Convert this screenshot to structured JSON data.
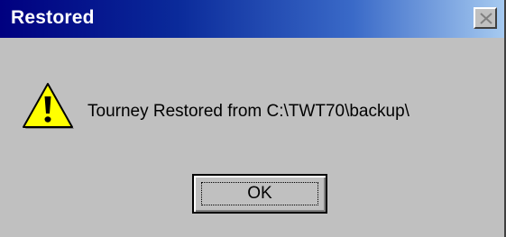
{
  "window": {
    "title": "Restored",
    "close_icon": "close-icon"
  },
  "message": {
    "icon": "warning-icon",
    "text": "Tourney Restored from C:\\TWT70\\backup\\"
  },
  "buttons": {
    "ok_label": "OK"
  },
  "colors": {
    "titlebar_start": "#000080",
    "titlebar_end": "#a6caf0",
    "face": "#c0c0c0",
    "warning_yellow": "#ffff00"
  }
}
